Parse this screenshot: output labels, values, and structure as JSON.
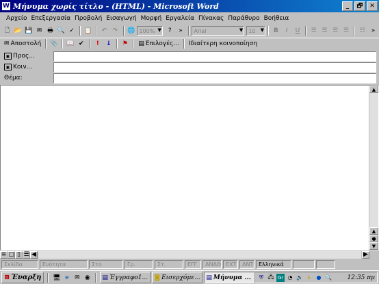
{
  "window": {
    "title": "Μήνυμα χωρίς τίτλο - (HTML) - Microsoft Word",
    "min": "_",
    "max": "🗗",
    "close": "✕",
    "app_icon": "W"
  },
  "menu": [
    {
      "label": "Αρχείο"
    },
    {
      "label": "Επεξεργασία"
    },
    {
      "label": "Προβολή"
    },
    {
      "label": "Εισαγωγή"
    },
    {
      "label": "Μορφή"
    },
    {
      "label": "Εργαλεία"
    },
    {
      "label": "Πίνακας"
    },
    {
      "label": "Παράθυρο"
    },
    {
      "label": "Βοήθεια"
    }
  ],
  "toolbar": {
    "zoom": "100%",
    "font": "Arial",
    "size": "10",
    "help": "?",
    "more": "»",
    "bold": "B",
    "italic": "I",
    "underline": "U"
  },
  "emailbar": {
    "send": "Αποστολή",
    "options": "Επιλογές...",
    "bcc": "Ιδιαίτερη κοινοποίηση"
  },
  "fields": {
    "to_label": "Προς...",
    "cc_label": "Κοιν...",
    "subject_label": "Θέμα:",
    "to_value": "",
    "cc_value": "",
    "subject_value": ""
  },
  "status": {
    "page": "Σελίδα",
    "section": "Ενότητα",
    "at": "Στο",
    "line": "Γρ.",
    "col": "Στ.",
    "rec": "ΕΓΓ",
    "trk": "ΑΝΑΘ",
    "ext": "ΕΧΤ",
    "ovr": "ΑΝΤ",
    "lang": "Ελληνικά"
  },
  "taskbar": {
    "start": "Έναρξη",
    "tasks": [
      {
        "label": "Έγγραφο1..."
      },
      {
        "label": "Εισερχόμε..."
      },
      {
        "label": "Μήνυμα ..."
      }
    ],
    "clock": "12:35 πμ",
    "lang_indicator": "Gr"
  },
  "icons": [
    "new-icon",
    "open-icon",
    "save-icon",
    "print-icon",
    "paste-icon",
    "undo-icon",
    "redo-icon",
    "attach-icon",
    "flag-icon",
    "importance-high-icon",
    "importance-low-icon"
  ],
  "colors": {
    "titlebar_start": "#000080",
    "titlebar_end": "#1084d0",
    "face": "#c0c0c0"
  }
}
